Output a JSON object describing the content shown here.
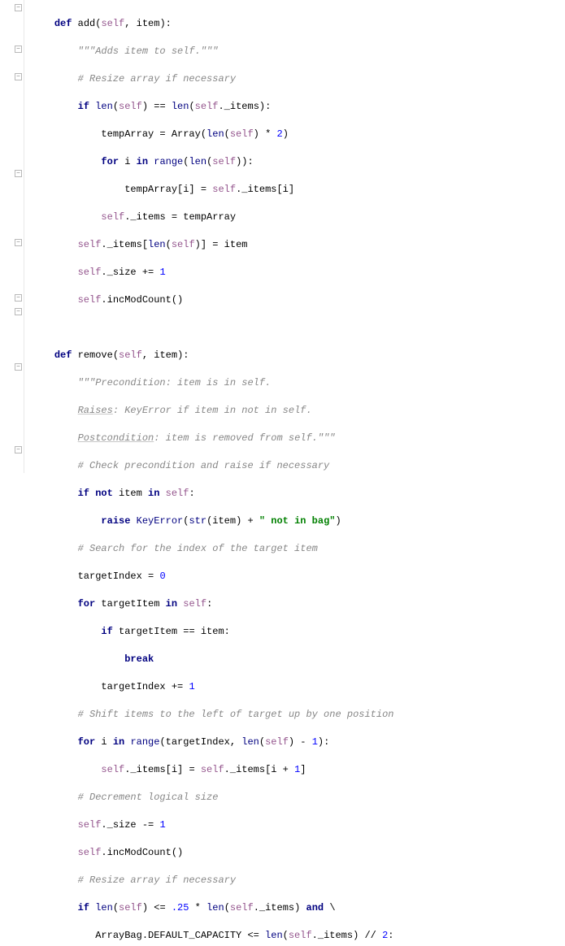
{
  "code": {
    "lines": [
      "    def add(self, item):",
      "        \"\"\"Adds item to self.\"\"\"",
      "        # Resize array if necessary",
      "        if len(self) == len(self._items):",
      "            tempArray = Array(len(self) * 2)",
      "            for i in range(len(self)):",
      "                tempArray[i] = self._items[i]",
      "            self._items = tempArray",
      "        self._items[len(self)] = item",
      "        self._size += 1",
      "        self.incModCount()",
      "",
      "    def remove(self, item):",
      "        \"\"\"Precondition: item is in self.",
      "        Raises: KeyError if item in not in self.",
      "        Postcondition: item is removed from self.\"\"\"",
      "        # Check precondition and raise if necessary",
      "        if not item in self:",
      "            raise KeyError(str(item) + \" not in bag\")",
      "        # Search for the index of the target item",
      "        targetIndex = 0",
      "        for targetItem in self:",
      "            if targetItem == item:",
      "                break",
      "            targetIndex += 1",
      "        # Shift items to the left of target up by one position",
      "        for i in range(targetIndex, len(self) - 1):",
      "            self._items[i] = self._items[i + 1]",
      "        # Decrement logical size",
      "        self._size -= 1",
      "        self.incModCount()",
      "        # Resize array if necessary",
      "        if len(self) <= .25 * len(self._items) and \\",
      "           ArrayBag.DEFAULT_CAPACITY <= len(self._items) // 2:"
    ]
  },
  "tokens": {
    "keywords": [
      "def",
      "if",
      "for",
      "in",
      "not",
      "raise",
      "break",
      "and"
    ],
    "builtins": [
      "len",
      "range",
      "str",
      "KeyError"
    ],
    "self": "self",
    "strings": [
      "\"\"\"Adds item to self.\"\"\"",
      "\"\"\"Precondition: item is in self.",
      "Raises: KeyError if item in not in self.",
      "Postcondition: item is removed from self.\"\"\"",
      "\" not in bag\""
    ],
    "comments": [
      "# Resize array if necessary",
      "# Check precondition and raise if necessary",
      "# Search for the index of the target item",
      "# Shift items to the left of target up by one position",
      "# Decrement logical size",
      "# Resize array if necessary"
    ],
    "numbers": [
      "2",
      "1",
      "0",
      ".25"
    ]
  },
  "fold_markers": [
    0,
    3,
    5,
    12,
    17,
    21,
    22,
    26,
    32
  ]
}
